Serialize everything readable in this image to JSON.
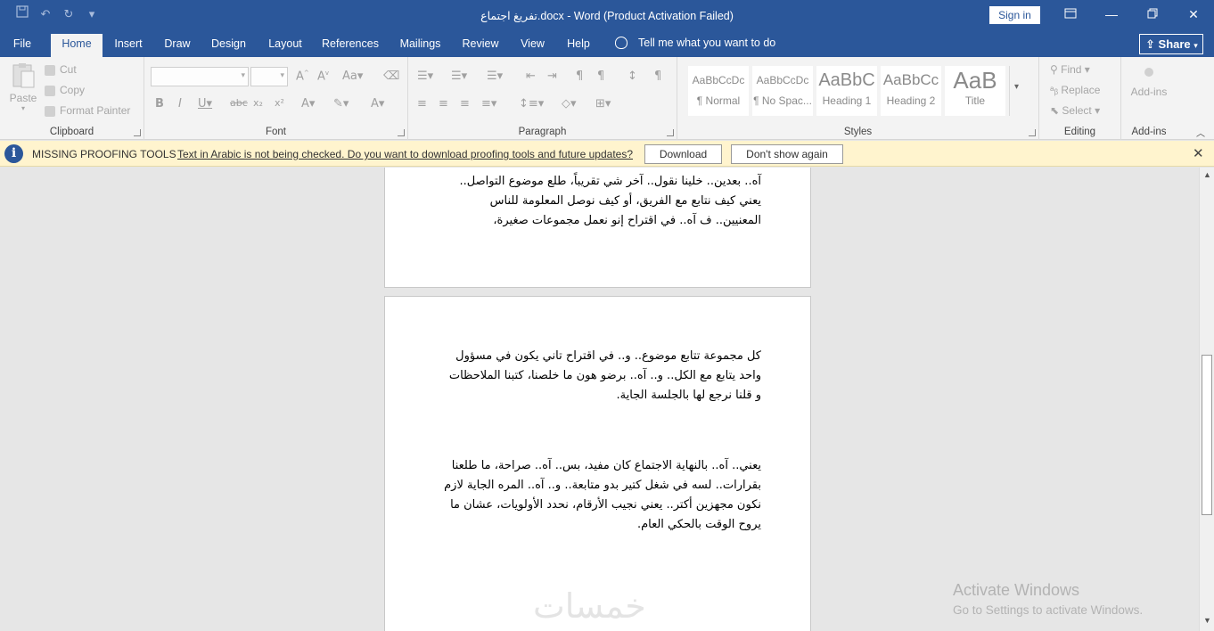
{
  "titlebar": {
    "title": "تفريغ اجتماع.docx  -  Word (Product Activation Failed)",
    "sign_in": "Sign in",
    "qat": [
      "save-icon",
      "undo-icon",
      "redo-icon",
      "customize-icon"
    ],
    "window_buttons": [
      "ribbon-display-icon",
      "minimize-icon",
      "restore-icon",
      "close-icon"
    ]
  },
  "tabs": {
    "items": [
      "File",
      "Home",
      "Insert",
      "Draw",
      "Design",
      "Layout",
      "References",
      "Mailings",
      "Review",
      "View",
      "Help"
    ],
    "active": "Home",
    "tell_me": "Tell me what you want to do",
    "share": "Share"
  },
  "ribbon": {
    "clipboard": {
      "label": "Clipboard",
      "paste": "Paste",
      "cut": "Cut",
      "copy": "Copy",
      "format_painter": "Format Painter"
    },
    "font": {
      "label": "Font"
    },
    "paragraph": {
      "label": "Paragraph"
    },
    "styles": {
      "label": "Styles",
      "items": [
        {
          "sample": "AaBbCcDc",
          "name": "¶ Normal"
        },
        {
          "sample": "AaBbCcDc",
          "name": "¶ No Spac..."
        },
        {
          "sample": "AaBbC",
          "name": "Heading 1"
        },
        {
          "sample": "AaBbCc",
          "name": "Heading 2"
        },
        {
          "sample": "AaB",
          "name": "Title"
        }
      ]
    },
    "editing": {
      "label": "Editing",
      "find": "Find",
      "replace": "Replace",
      "select": "Select"
    },
    "addins": {
      "label": "Add-ins",
      "button": "Add-ins"
    }
  },
  "message_bar": {
    "title": "MISSING PROOFING TOOLS",
    "text": "Text in Arabic is not being checked. Do you want to download proofing tools and future updates?",
    "download": "Download",
    "dont_show": "Don't show again"
  },
  "document": {
    "page1_paragraph": "آه.. بعدين.. خلينا نقول.. آخر شي تقريباً، طلع موضوع التواصل.. يعني كيف نتابع مع الفريق، أو كيف نوصل المعلومة للناس المعنيين.. ف آه.. في اقتراح إنو نعمل مجموعات صغيرة،",
    "page2_paragraph1": "كل مجموعة تتابع موضوع.. و.. في اقتراح تاني يكون في مسؤول واحد يتابع مع الكل.. و.. آه.. برضو هون ما خلصنا، كتبنا الملاحظات و قلنا نرجع لها بالجلسة الجاية.",
    "page2_paragraph2": "يعني.. آه.. بالنهاية الاجتماع كان مفيد، بس.. آه.. صراحة، ما طلعنا بقرارات.. لسه في شغل كتير بدو متابعة.. و.. آه.. المره الجاية لازم نكون مجهزين أكتر.. يعني نجيب الأرقام، نحدد الأولويات، عشان ما يروح الوقت بالحكي العام.",
    "watermark": "خمسات"
  },
  "activation": {
    "line1": "Activate Windows",
    "line2": "Go to Settings to activate Windows."
  }
}
